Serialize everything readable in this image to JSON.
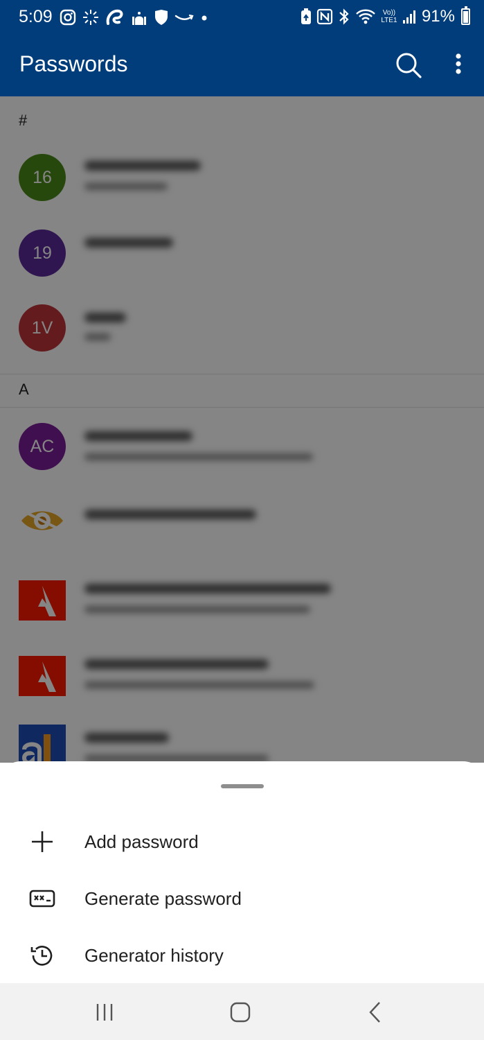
{
  "status_bar": {
    "time": "5:09",
    "left_icons": [
      "instagram-icon",
      "sparkle-icon",
      "airtel-icon",
      "mosque-icon",
      "shield-icon",
      "amazon-icon",
      "dot-icon"
    ],
    "right_icons": [
      "battery-saver-icon",
      "nfc-icon",
      "bluetooth-icon",
      "wifi-icon",
      "volte-icon",
      "signal-icon"
    ],
    "volte_text": "Vo)) LTE1",
    "battery_percent": "91%",
    "battery_level": 0.91
  },
  "app_bar": {
    "title": "Passwords",
    "actions": [
      "search-icon",
      "more-vert-icon"
    ]
  },
  "list": {
    "sections": [
      {
        "header": "#",
        "items": [
          {
            "avatar_text": "16",
            "avatar_color": "#4c8a1a"
          },
          {
            "avatar_text": "19",
            "avatar_color": "#5a2b9a"
          },
          {
            "avatar_text": "1V",
            "avatar_color": "#c0343b"
          }
        ]
      },
      {
        "header": "A",
        "items": [
          {
            "avatar_text": "AC",
            "avatar_color": "#7b1d97"
          },
          {
            "logo": "eye-logo-icon"
          },
          {
            "logo": "adobe-logo-icon"
          },
          {
            "logo": "adobe-logo-icon"
          },
          {
            "logo": "a-logo-icon"
          }
        ]
      }
    ]
  },
  "bottom_sheet": {
    "items": [
      {
        "label": "Add password",
        "icon": "plus-icon"
      },
      {
        "label": "Generate password",
        "icon": "password-key-icon"
      },
      {
        "label": "Generator history",
        "icon": "history-icon"
      }
    ]
  },
  "nav_bar": {
    "buttons": [
      "recents-icon",
      "home-icon",
      "back-icon"
    ]
  },
  "colors": {
    "primary": "#003d7a",
    "scrim": "#000000",
    "surface": "#ffffff"
  }
}
